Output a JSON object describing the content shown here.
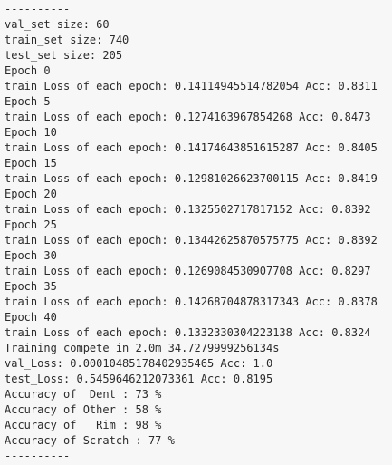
{
  "output": {
    "lines": [
      "----------",
      "val_set size: 60",
      "train_set size: 740",
      "test_set size: 205",
      "Epoch 0",
      "train Loss of each epoch: 0.14114945514782054 Acc: 0.8311",
      "Epoch 5",
      "train Loss of each epoch: 0.1274163967854268 Acc: 0.8473",
      "Epoch 10",
      "train Loss of each epoch: 0.14174643851615287 Acc: 0.8405",
      "Epoch 15",
      "train Loss of each epoch: 0.12981026623700115 Acc: 0.8419",
      "Epoch 20",
      "train Loss of each epoch: 0.1325502717817152 Acc: 0.8392",
      "Epoch 25",
      "train Loss of each epoch: 0.13442625870575775 Acc: 0.8392",
      "Epoch 30",
      "train Loss of each epoch: 0.1269084530907708 Acc: 0.8297",
      "Epoch 35",
      "train Loss of each epoch: 0.14268704878317343 Acc: 0.8378",
      "Epoch 40",
      "train Loss of each epoch: 0.1332330304223138 Acc: 0.8324",
      "Training compete in 2.0m 34.7279999256134s",
      "val_Loss: 0.00010485178402935465 Acc: 1.0",
      "test_Loss: 0.5459646212073361 Acc: 0.8195",
      "Accuracy of  Dent : 73 %",
      "Accuracy of Other : 58 %",
      "Accuracy of   Rim : 98 %",
      "Accuracy of Scratch : 77 %",
      "----------"
    ]
  }
}
